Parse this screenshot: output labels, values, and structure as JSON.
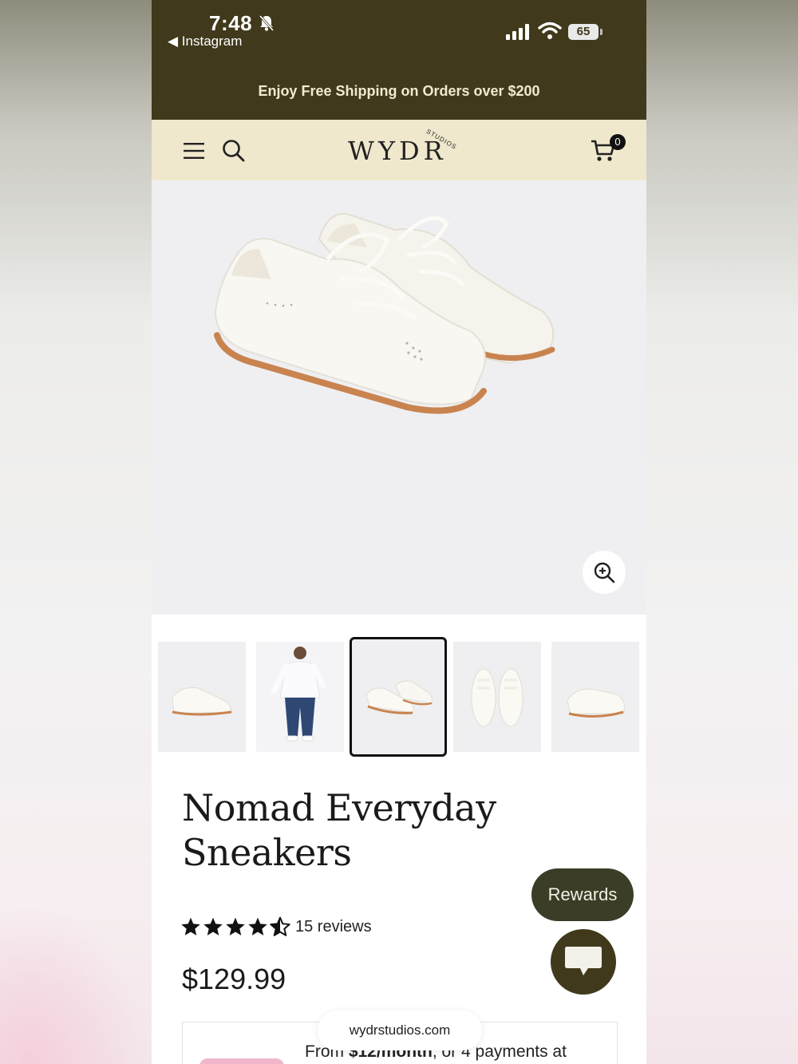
{
  "status_bar": {
    "time": "7:48",
    "back_app": "◀ Instagram",
    "battery": "65"
  },
  "promo": {
    "text": "Enjoy Free Shipping on Orders over $200"
  },
  "header": {
    "logo": "WYDR",
    "logo_small": "STUDIOS",
    "cart_count": "0"
  },
  "hero": {
    "icon": "shoe-product-image"
  },
  "thumbnails": [
    {
      "name": "shoe side view",
      "selected": false
    },
    {
      "name": "model wearing sneakers",
      "selected": false
    },
    {
      "name": "pair angled view",
      "selected": true
    },
    {
      "name": "pair top view",
      "selected": false
    },
    {
      "name": "shoe back angle",
      "selected": false
    }
  ],
  "product": {
    "title_line1": "Nomad Everyday",
    "title_line2": "Sneakers",
    "rating": 4.5,
    "reviews": "15 reviews",
    "price": "$129.99"
  },
  "rewards": {
    "label": "Rewards"
  },
  "payment": {
    "text_prefix": "From ",
    "text_bold": "$12/month",
    "text_suffix": ", or 4 payments at"
  },
  "browser": {
    "url": "wydrstudios.com"
  },
  "colors": {
    "top_bar": "#40391b",
    "header_bg": "#efe8cd",
    "rewards_bg": "#3b3d26"
  }
}
